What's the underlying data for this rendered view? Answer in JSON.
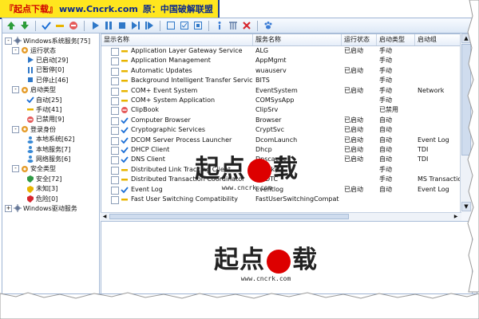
{
  "banner": {
    "site_name": "『起点下载』",
    "url": "www.Cncrk.com",
    "original_label": "原：",
    "group": "中国破解联盟"
  },
  "toolbar": {
    "icons": [
      "arrow-up",
      "arrow-down",
      "check",
      "minus",
      "stop-circle",
      "play",
      "pause",
      "stop",
      "step-forward",
      "pause-step",
      "square",
      "checkbox",
      "square-dot",
      "info",
      "tools",
      "delete",
      "paw"
    ]
  },
  "tree": [
    {
      "label": "Windows系统服务[75]",
      "level": 0,
      "icon": "services-icon",
      "expander": "-"
    },
    {
      "label": "运行状态",
      "level": 1,
      "icon": "gear-icon",
      "expander": "-"
    },
    {
      "label": "已启动[29]",
      "level": 2,
      "icon": "play-icon"
    },
    {
      "label": "已暂停[0]",
      "level": 2,
      "icon": "pause-icon"
    },
    {
      "label": "已停止[46]",
      "level": 2,
      "icon": "stop-icon"
    },
    {
      "label": "启动类型",
      "level": 1,
      "icon": "gear-icon",
      "expander": "-"
    },
    {
      "label": "自动[25]",
      "level": 2,
      "icon": "check-icon"
    },
    {
      "label": "手动[41]",
      "level": 2,
      "icon": "minus-icon"
    },
    {
      "label": "已禁用[9]",
      "level": 2,
      "icon": "disabled-icon"
    },
    {
      "label": "登录身份",
      "level": 1,
      "icon": "gear-icon",
      "expander": "-"
    },
    {
      "label": "本地系统[62]",
      "level": 2,
      "icon": "user-icon"
    },
    {
      "label": "本地服务[7]",
      "level": 2,
      "icon": "user-icon"
    },
    {
      "label": "网络服务[6]",
      "level": 2,
      "icon": "user-icon"
    },
    {
      "label": "安全类型",
      "level": 1,
      "icon": "gear-icon",
      "expander": "-"
    },
    {
      "label": "安全[72]",
      "level": 2,
      "icon": "safe-icon"
    },
    {
      "label": "未知[3]",
      "level": 2,
      "icon": "unknown-icon"
    },
    {
      "label": "危险[0]",
      "level": 2,
      "icon": "danger-icon"
    },
    {
      "label": "Windows驱动服务",
      "level": 0,
      "icon": "services-icon",
      "expander": "+"
    }
  ],
  "table": {
    "columns": [
      "显示名称",
      "服务名称",
      "运行状态",
      "启动类型",
      "启动组"
    ],
    "rows": [
      {
        "display": "Application Layer Gateway Service",
        "service": "ALG",
        "status": "已启动",
        "start": "手动",
        "group": "",
        "icon": "minus"
      },
      {
        "display": "Application Management",
        "service": "AppMgmt",
        "status": "",
        "start": "手动",
        "group": "",
        "icon": "minus"
      },
      {
        "display": "Automatic Updates",
        "service": "wuauserv",
        "status": "已启动",
        "start": "手动",
        "group": "",
        "icon": "minus"
      },
      {
        "display": "Background Intelligent Transfer Service",
        "service": "BITS",
        "status": "",
        "start": "手动",
        "group": "",
        "icon": "minus"
      },
      {
        "display": "COM+ Event System",
        "service": "EventSystem",
        "status": "已启动",
        "start": "手动",
        "group": "Network",
        "icon": "minus"
      },
      {
        "display": "COM+ System Application",
        "service": "COMSysApp",
        "status": "",
        "start": "手动",
        "group": "",
        "icon": "minus"
      },
      {
        "display": "ClipBook",
        "service": "ClipSrv",
        "status": "",
        "start": "已禁用",
        "group": "",
        "icon": "disabled"
      },
      {
        "display": "Computer Browser",
        "service": "Browser",
        "status": "已启动",
        "start": "自动",
        "group": "",
        "icon": "check"
      },
      {
        "display": "Cryptographic Services",
        "service": "CryptSvc",
        "status": "已启动",
        "start": "自动",
        "group": "",
        "icon": "check"
      },
      {
        "display": "DCOM Server Process Launcher",
        "service": "DcomLaunch",
        "status": "已启动",
        "start": "自动",
        "group": "Event Log",
        "icon": "check"
      },
      {
        "display": "DHCP Client",
        "service": "Dhcp",
        "status": "已启动",
        "start": "自动",
        "group": "TDI",
        "icon": "check"
      },
      {
        "display": "DNS Client",
        "service": "Dnscache",
        "status": "已启动",
        "start": "自动",
        "group": "TDI",
        "icon": "check"
      },
      {
        "display": "Distributed Link Tracking Client",
        "service": "TrkWks",
        "status": "",
        "start": "手动",
        "group": "",
        "icon": "minus"
      },
      {
        "display": "Distributed Transaction Coordinator",
        "service": "MSDTC",
        "status": "",
        "start": "手动",
        "group": "MS Transaction",
        "icon": "minus"
      },
      {
        "display": "Event Log",
        "service": "Eventlog",
        "status": "已启动",
        "start": "自动",
        "group": "Event Log",
        "icon": "check"
      },
      {
        "display": "Fast User Switching Compatibility",
        "service": "FastUserSwitchingCompat",
        "status": "",
        "start": "",
        "group": "",
        "icon": "minus"
      }
    ]
  },
  "watermark": {
    "big_1": "起点",
    "big_2": "载",
    "url": "www.cncrk.com"
  },
  "colors": {
    "accent_blue": "#1f3f8f",
    "banner_yellow": "#ffe61e",
    "check_blue": "#1c6fd6",
    "minus_yellow": "#e8b400",
    "disabled_red": "#d7262e"
  }
}
